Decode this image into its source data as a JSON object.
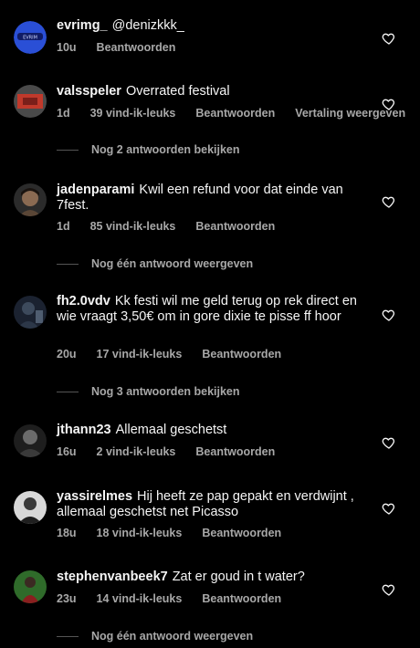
{
  "comments": [
    {
      "username": "evrimg_",
      "text": "@denizkkk_",
      "time": "10u",
      "likes": "",
      "reply": "Beantwoorden",
      "translate": "",
      "replies": "",
      "avatar_colors": [
        "#2a4fd6",
        "#1a2f8a"
      ]
    },
    {
      "username": "valsspeler",
      "text": "Overrated festival",
      "time": "1d",
      "likes": "39 vind-ik-leuks",
      "reply": "Beantwoorden",
      "translate": "Vertaling weergeven",
      "replies": "Nog 2 antwoorden bekijken",
      "avatar_colors": [
        "#c0392b",
        "#5a5a5a"
      ]
    },
    {
      "username": "jadenparami",
      "text": "Kwil een refund voor dat einde van 7fest.",
      "time": "1d",
      "likes": "85 vind-ik-leuks",
      "reply": "Beantwoorden",
      "translate": "",
      "replies": "Nog één antwoord weergeven",
      "avatar_colors": [
        "#8a6a52",
        "#2b2b2b"
      ]
    },
    {
      "username": "fh2.0vdv",
      "text": "Kk festi wil me geld terug op rek direct en wie vraagt 3,50€ om in gore dixie te pisse ff hoor",
      "time": "20u",
      "likes": "17 vind-ik-leuks",
      "reply": "Beantwoorden",
      "translate": "",
      "replies": "Nog 3 antwoorden bekijken",
      "avatar_colors": [
        "#3d4a5c",
        "#1b2230"
      ]
    },
    {
      "username": "jthann23",
      "text": "Allemaal geschetst",
      "time": "16u",
      "likes": "2 vind-ik-leuks",
      "reply": "Beantwoorden",
      "translate": "",
      "replies": "",
      "avatar_colors": [
        "#6b6b6b",
        "#1e1e1e"
      ]
    },
    {
      "username": "yassirelmes",
      "text": "Hij heeft ze pap gepakt en verdwijnt , allemaal geschetst net Picasso",
      "time": "18u",
      "likes": "18 vind-ik-leuks",
      "reply": "Beantwoorden",
      "translate": "",
      "replies": "",
      "avatar_colors": [
        "#d8d8d8",
        "#3a3a3a"
      ]
    },
    {
      "username": "stephenvanbeek7",
      "text": "Zat er goud in t water?",
      "time": "23u",
      "likes": "14 vind-ik-leuks",
      "reply": "Beantwoorden",
      "translate": "",
      "replies": "Nog één antwoord weergeven",
      "avatar_colors": [
        "#2f6b2a",
        "#8a1f1f"
      ]
    }
  ]
}
